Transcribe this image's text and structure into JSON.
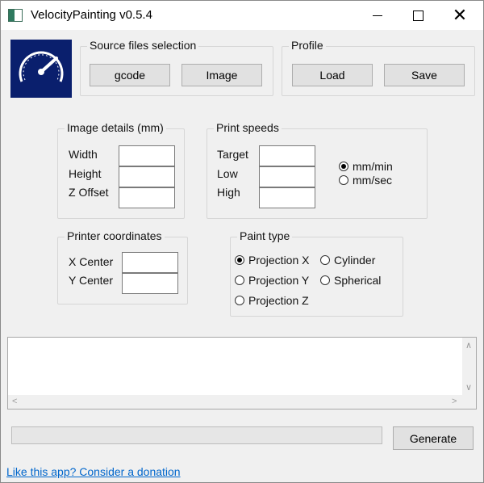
{
  "window": {
    "title": "VelocityPainting v0.5.4"
  },
  "source_files": {
    "label": "Source files selection",
    "gcode": "gcode",
    "image": "Image"
  },
  "profile": {
    "label": "Profile",
    "load": "Load",
    "save": "Save"
  },
  "image_details": {
    "label": "Image details (mm)",
    "width": "Width",
    "height": "Height",
    "z_offset": "Z Offset",
    "width_value": "",
    "height_value": "",
    "z_offset_value": ""
  },
  "print_speeds": {
    "label": "Print speeds",
    "target": "Target",
    "low": "Low",
    "high": "High",
    "target_value": "",
    "low_value": "",
    "high_value": "",
    "unit_mm_min": "mm/min",
    "unit_mm_sec": "mm/sec",
    "selected_unit": "mm/min"
  },
  "printer_coords": {
    "label": "Printer coordinates",
    "x_center": "X Center",
    "y_center": "Y Center",
    "x_value": "",
    "y_value": ""
  },
  "paint_type": {
    "label": "Paint type",
    "proj_x": "Projection X",
    "proj_y": "Projection Y",
    "proj_z": "Projection Z",
    "cylinder": "Cylinder",
    "spherical": "Spherical",
    "selected": "Projection X"
  },
  "log": {
    "text": ""
  },
  "progress": {
    "value": 0
  },
  "generate": "Generate",
  "donation_link": "Like this app? Consider a donation",
  "icons": [
    "app-window-icon",
    "speedometer-logo-icon",
    "minimize-icon",
    "maximize-icon",
    "close-icon"
  ],
  "colors": {
    "logo_bg": "#0a1f6d",
    "link": "#0066cc",
    "progress": "#06b025"
  }
}
